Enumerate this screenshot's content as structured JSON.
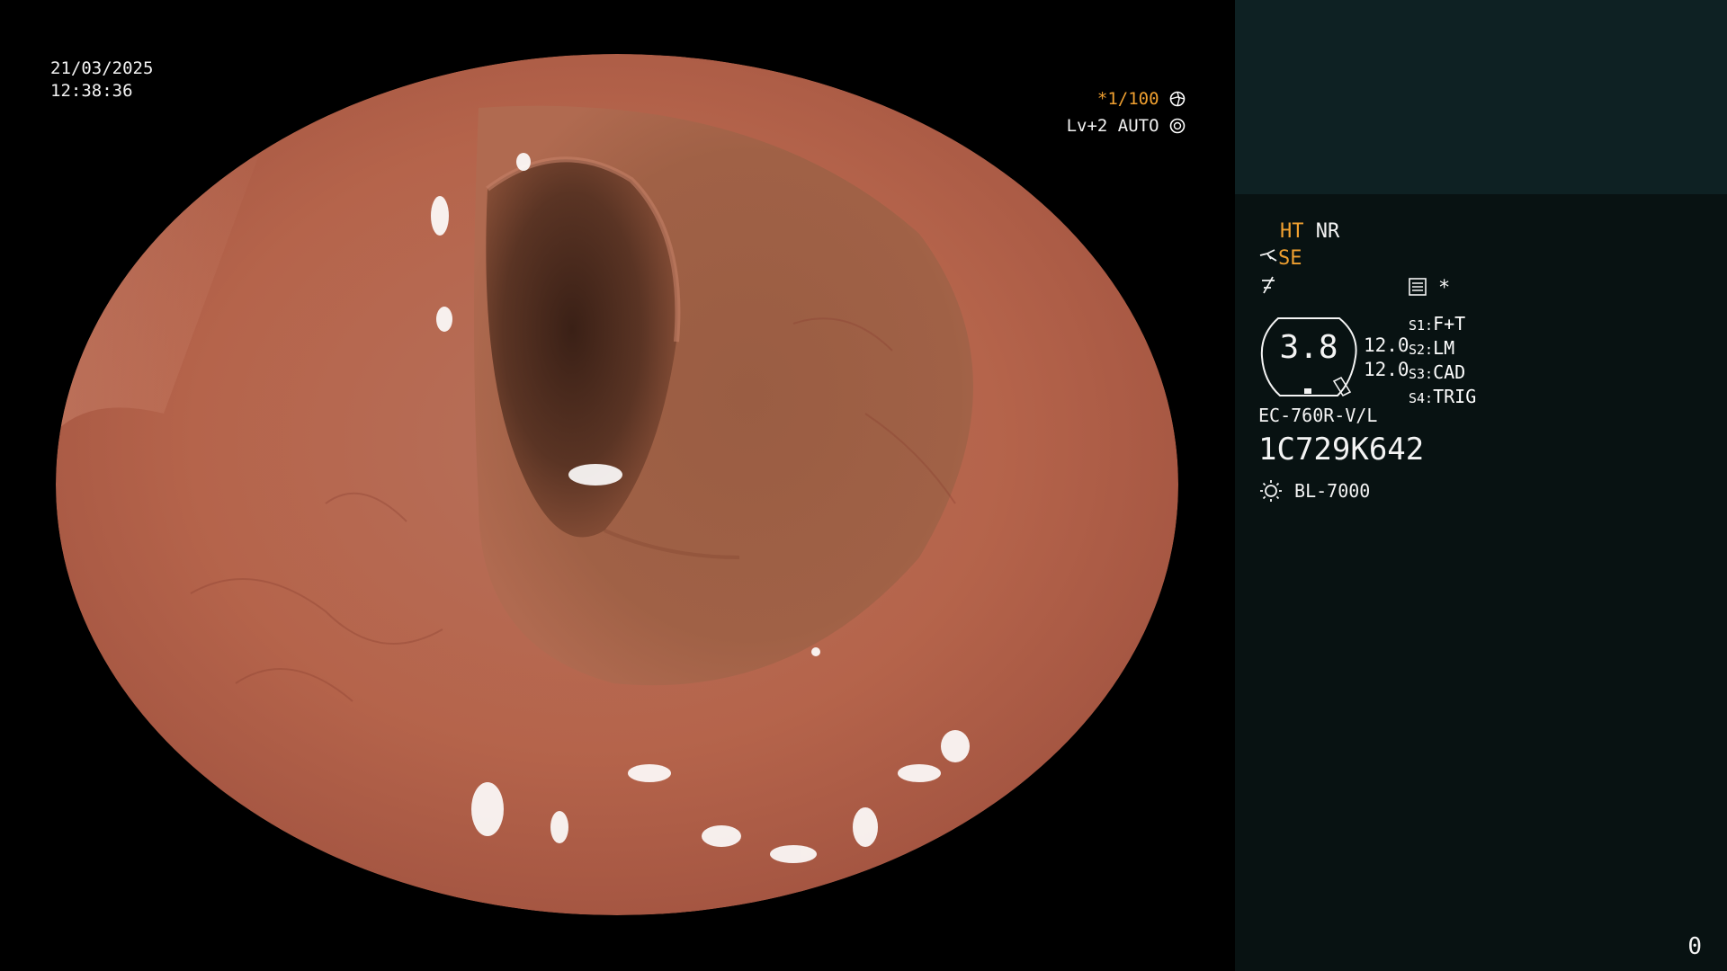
{
  "overlay": {
    "date": "21/03/2025",
    "time": "12:38:36",
    "shutter_prefix": "*",
    "shutter": "1/100",
    "level": "Lv+2",
    "auto": "AUTO"
  },
  "panel": {
    "ht": "HT",
    "nr": "NR",
    "se": "SE",
    "magnification": "3.8",
    "value_a": "12.0",
    "value_b": "12.0",
    "switches": [
      {
        "key": "S1:",
        "value": "F+T"
      },
      {
        "key": "S2:",
        "value": "LM"
      },
      {
        "key": "S3:",
        "value": "CAD"
      },
      {
        "key": "S4:",
        "value": "TRIG"
      }
    ],
    "asterisk": "*",
    "scope_model": "EC-760R-V/L",
    "serial": "1C729K642",
    "light_source": "BL-7000",
    "corner_number": "0"
  },
  "colors": {
    "accent_orange": "#f0a030",
    "panel_bg": "#081212",
    "panel_top_bg": "#0e2123",
    "mucosa": "#b8674e"
  },
  "icons": [
    "aperture-icon",
    "iris-icon",
    "scope-tool-icon",
    "edge-enhance-icon",
    "menu-list-icon",
    "light-bulb-icon"
  ]
}
